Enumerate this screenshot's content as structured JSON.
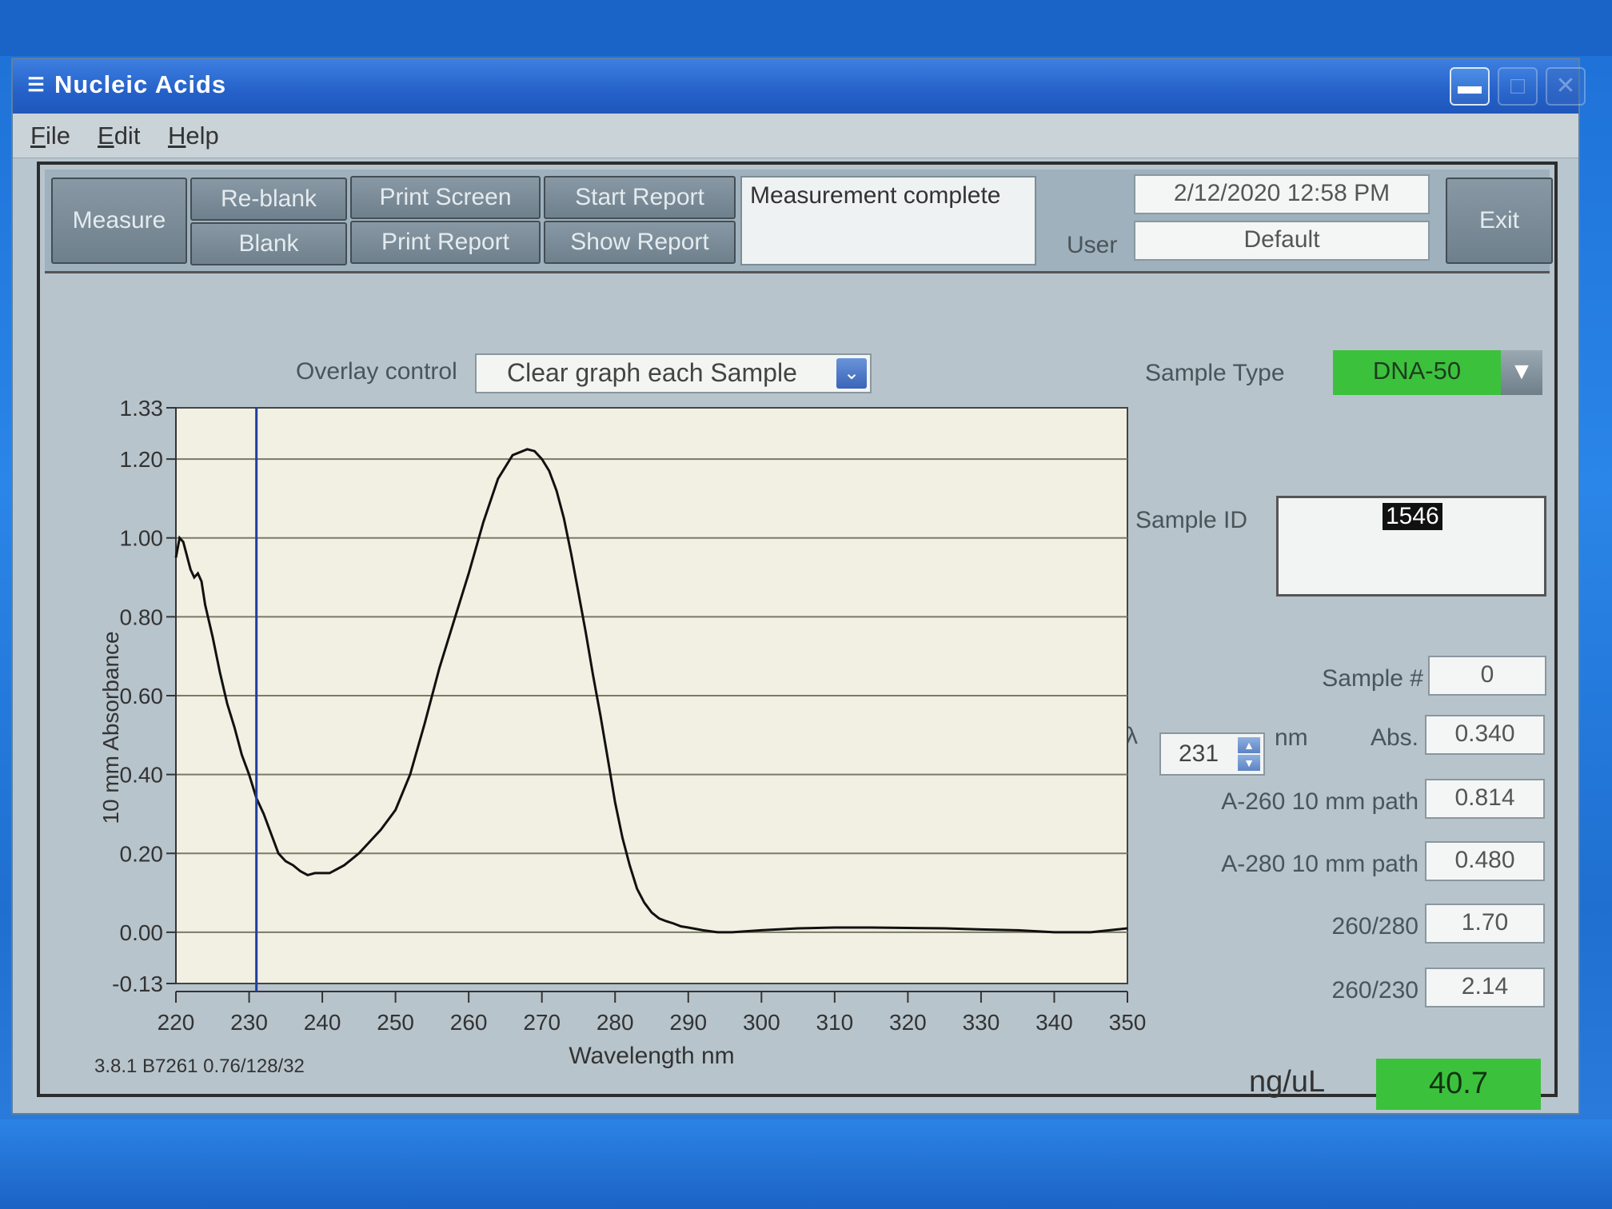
{
  "window": {
    "title": "Nucleic Acids",
    "minimize_glyph": "▬",
    "maximize_glyph": "□",
    "close_glyph": "✕"
  },
  "menu": {
    "items": [
      "File",
      "Edit",
      "Help"
    ]
  },
  "toolbar": {
    "measure_label": "Measure",
    "reblank_label": "Re-blank",
    "blank_label": "Blank",
    "print_screen_label": "Print Screen",
    "print_report_label": "Print Report",
    "start_report_label": "Start Report",
    "show_report_label": "Show Report",
    "exit_label": "Exit",
    "status": "Measurement complete",
    "datetime": "2/12/2020  12:58 PM",
    "user_label": "User",
    "user_value": "Default"
  },
  "overlay": {
    "label": "Overlay control",
    "value": "Clear graph each Sample"
  },
  "sample_type": {
    "label": "Sample Type",
    "value": "DNA-50"
  },
  "sample_id": {
    "label": "Sample ID",
    "value": "1546"
  },
  "readings": {
    "sample_num_label": "Sample #",
    "sample_num": "0",
    "lambda_symbol": "λ",
    "lambda_value": "231",
    "lambda_unit": "nm",
    "abs_label": "Abs.",
    "abs_value": "0.340",
    "a260_label": "A-260 10 mm path",
    "a260_value": "0.814",
    "a280_label": "A-280 10 mm path",
    "a280_value": "0.480",
    "r260_280_label": "260/280",
    "r260_280_value": "1.70",
    "r260_230_label": "260/230",
    "r260_230_value": "2.14",
    "ngul_label": "ng/uL",
    "ngul_value": "40.7"
  },
  "version": "3.8.1 B7261 0.76/128/32",
  "colors": {
    "green_field": "#3cc13c",
    "plot_bg": "#f2f0e2",
    "cursor": "#1f3f9f",
    "curve": "#111111"
  },
  "chart_data": {
    "type": "line",
    "xlabel": "Wavelength nm",
    "ylabel": "10 mm Absorbance",
    "xlim": [
      220,
      350
    ],
    "ylim": [
      -0.13,
      1.33
    ],
    "x_ticks": [
      220,
      230,
      240,
      250,
      260,
      270,
      280,
      290,
      300,
      310,
      320,
      330,
      340,
      350
    ],
    "y_ticks": [
      1.33,
      1.2,
      1.0,
      0.8,
      0.6,
      0.4,
      0.2,
      0.0,
      -0.13
    ],
    "y_tick_labels": [
      "1.33",
      "1.20",
      "1.00",
      "0.80",
      "0.60",
      "0.40",
      "0.20",
      "0.00",
      "-0.13"
    ],
    "grid_y": [
      1.2,
      1.0,
      0.8,
      0.6,
      0.4,
      0.2,
      0.0
    ],
    "cursor_x": 231,
    "series": [
      {
        "x": [
          220,
          220.5,
          221,
          222,
          222.5,
          223,
          223.5,
          224,
          225,
          226,
          227,
          228,
          229,
          230,
          231,
          232,
          233,
          234,
          235,
          236,
          237,
          238,
          239,
          240,
          241,
          242,
          243,
          244,
          245,
          246,
          248,
          250,
          252,
          254,
          256,
          258,
          260,
          262,
          264,
          266,
          268,
          269,
          270,
          271,
          272,
          273,
          274,
          275,
          276,
          277,
          278,
          279,
          280,
          281,
          282,
          283,
          284,
          285,
          286,
          287,
          288,
          289,
          290,
          292,
          294,
          296,
          300,
          305,
          310,
          315,
          320,
          325,
          330,
          335,
          340,
          345,
          350
        ],
        "y": [
          0.95,
          1.0,
          0.99,
          0.92,
          0.9,
          0.91,
          0.89,
          0.83,
          0.75,
          0.66,
          0.58,
          0.52,
          0.45,
          0.4,
          0.34,
          0.3,
          0.25,
          0.2,
          0.18,
          0.17,
          0.155,
          0.145,
          0.15,
          0.15,
          0.15,
          0.16,
          0.17,
          0.185,
          0.2,
          0.22,
          0.26,
          0.31,
          0.4,
          0.53,
          0.67,
          0.79,
          0.91,
          1.04,
          1.15,
          1.21,
          1.225,
          1.22,
          1.2,
          1.17,
          1.12,
          1.05,
          0.96,
          0.86,
          0.76,
          0.65,
          0.55,
          0.44,
          0.33,
          0.24,
          0.17,
          0.11,
          0.075,
          0.05,
          0.035,
          0.028,
          0.022,
          0.015,
          0.012,
          0.005,
          0.0,
          0.0,
          0.005,
          0.01,
          0.012,
          0.012,
          0.011,
          0.01,
          0.007,
          0.005,
          0.0,
          0.0,
          0.01
        ]
      }
    ]
  }
}
